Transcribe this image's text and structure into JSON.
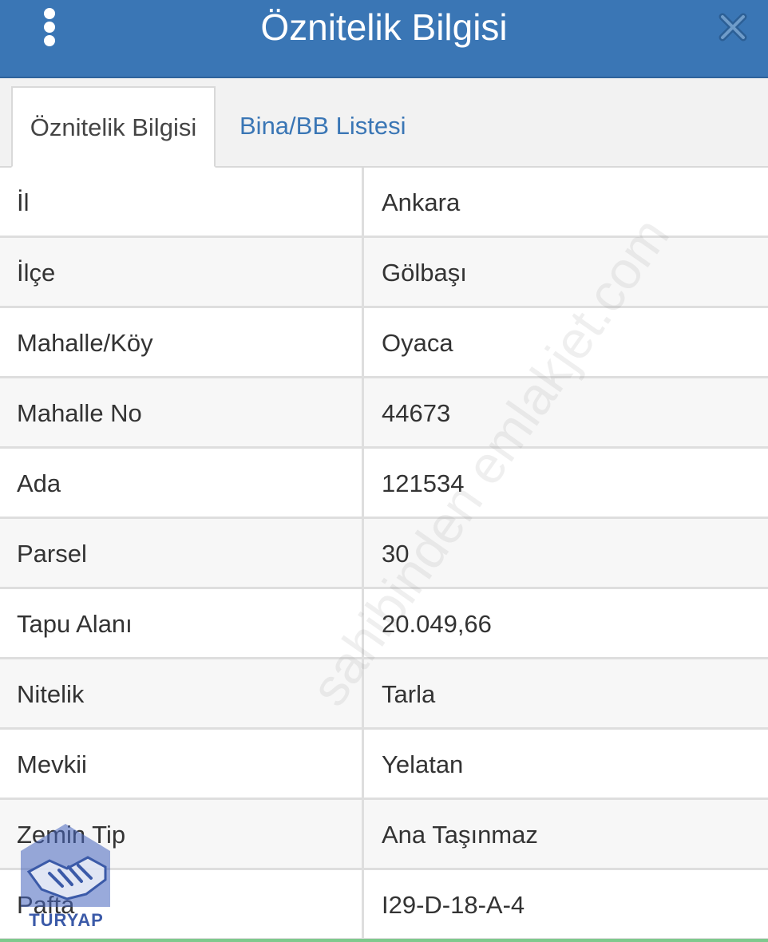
{
  "header": {
    "title": "Öznitelik Bilgisi",
    "menu_icon": "more-vertical-icon",
    "close_icon": "close-icon",
    "background_color": "#3a76b5"
  },
  "tabs": [
    {
      "label": "Öznitelik Bilgisi",
      "active": true
    },
    {
      "label": "Bina/BB Listesi",
      "active": false
    }
  ],
  "rows": [
    {
      "key": "İl",
      "value": "Ankara"
    },
    {
      "key": "İlçe",
      "value": "Gölbaşı"
    },
    {
      "key": "Mahalle/Köy",
      "value": "Oyaca"
    },
    {
      "key": "Mahalle No",
      "value": "44673"
    },
    {
      "key": "Ada",
      "value": "121534"
    },
    {
      "key": "Parsel",
      "value": "30"
    },
    {
      "key": "Tapu Alanı",
      "value": "20.049,66"
    },
    {
      "key": "Nitelik",
      "value": "Tarla"
    },
    {
      "key": "Mevkii",
      "value": "Yelatan"
    },
    {
      "key": "Zemin Tip",
      "value": "Ana Taşınmaz"
    },
    {
      "key": "Pafta",
      "value": "I29-D-18-A-4"
    }
  ],
  "watermark": "sahibinden emlakjet.com",
  "logo": {
    "text": "TURYAP",
    "icon": "handshake-logo-icon"
  }
}
